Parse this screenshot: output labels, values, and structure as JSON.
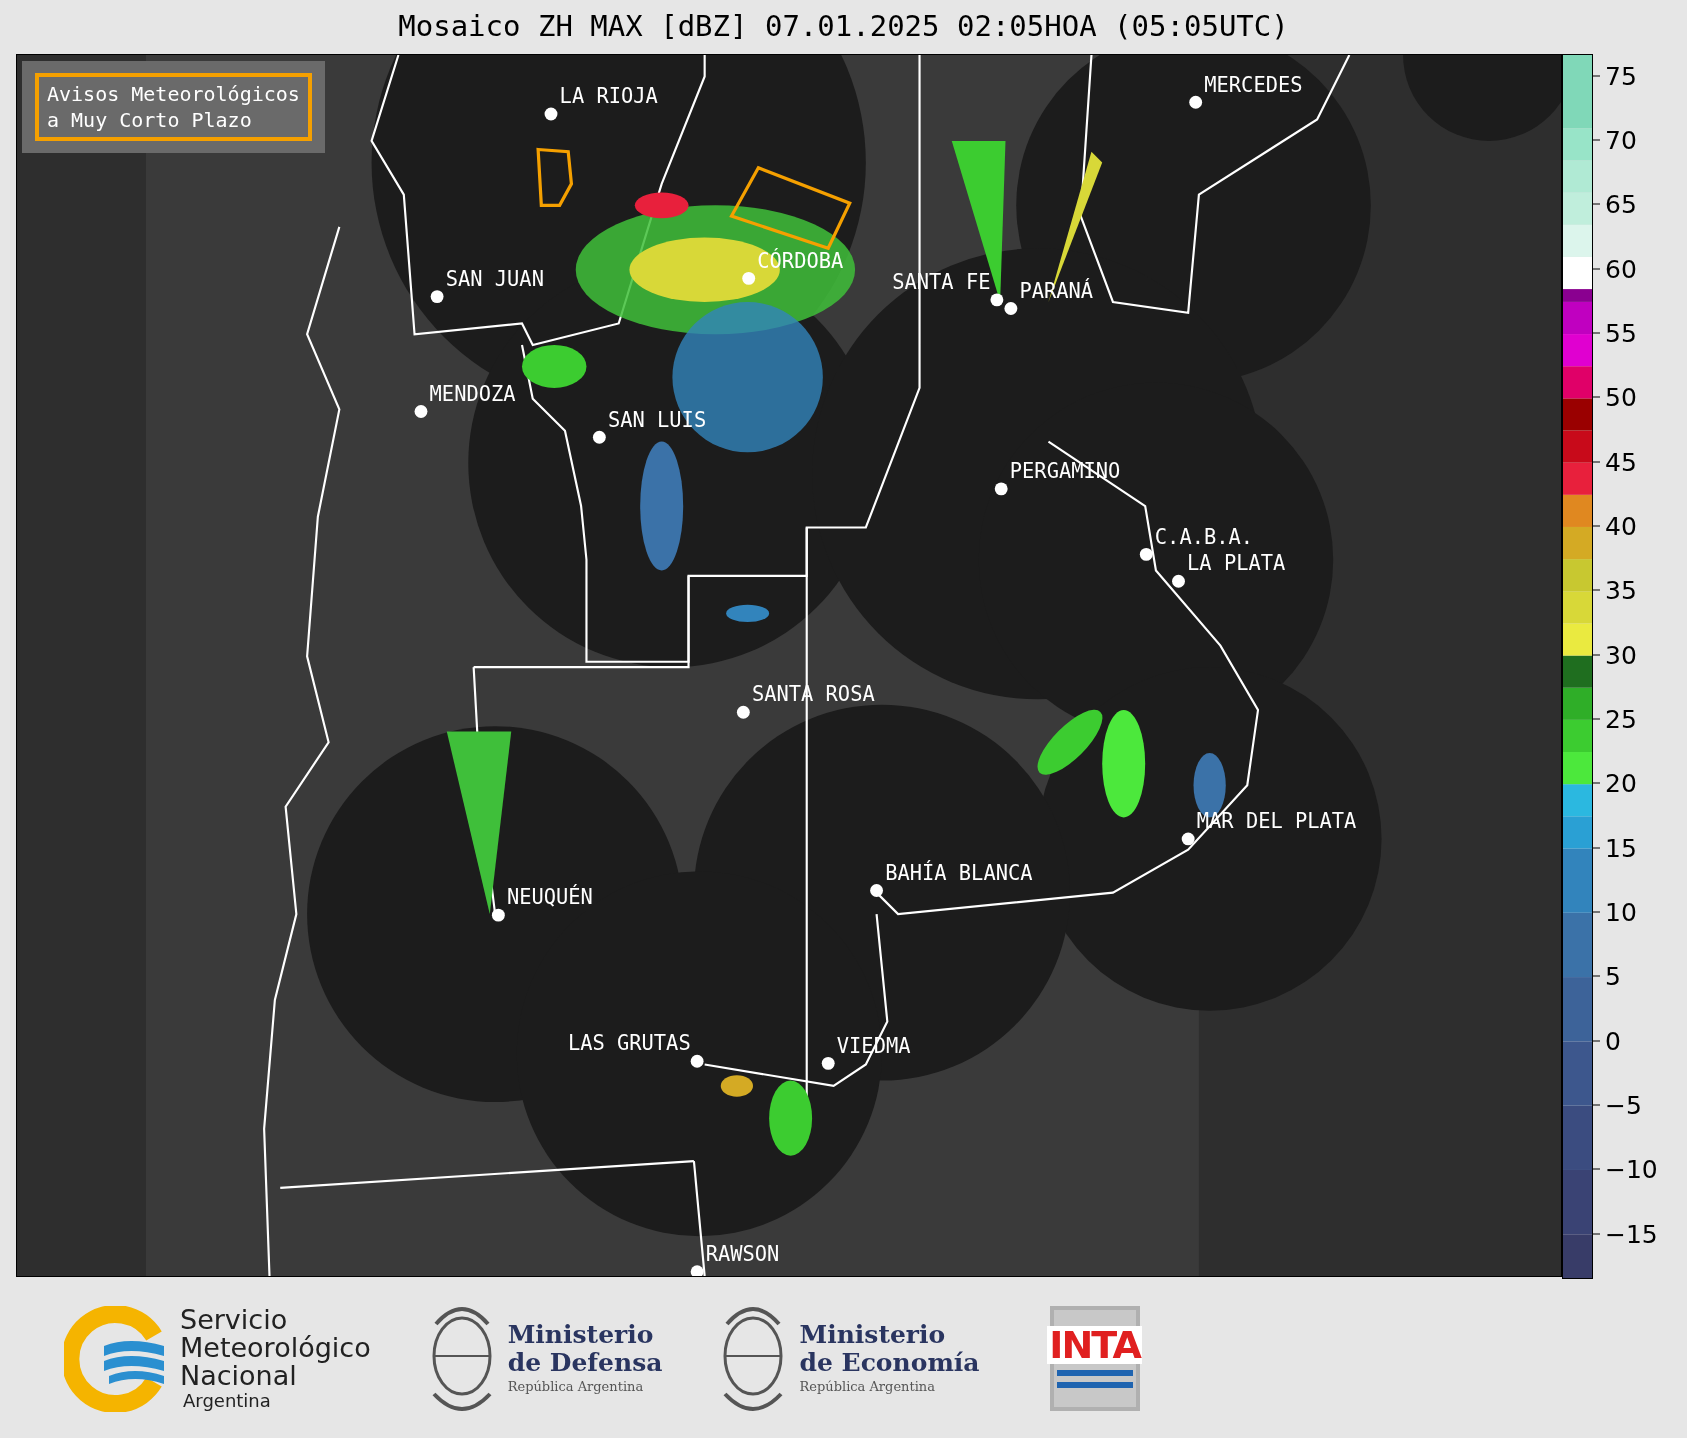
{
  "title": "Mosaico ZH MAX [dBZ] 07.01.2025 02:05HOA (05:05UTC)",
  "legend_box": {
    "lines": [
      "Avisos Meteorológicos",
      "a Muy Corto Plazo"
    ]
  },
  "cities": [
    {
      "name": "LA RIOJA"
    },
    {
      "name": "MERCEDES"
    },
    {
      "name": "CÓRDOBA"
    },
    {
      "name": "SAN JUAN"
    },
    {
      "name": "SANTA FE"
    },
    {
      "name": "PARANÁ"
    },
    {
      "name": "MENDOZA"
    },
    {
      "name": "SAN LUIS"
    },
    {
      "name": "PERGAMINO"
    },
    {
      "name": "C.A.B.A."
    },
    {
      "name": "LA PLATA"
    },
    {
      "name": "SANTA ROSA"
    },
    {
      "name": "MAR DEL PLATA"
    },
    {
      "name": "BAHÍA BLANCA"
    },
    {
      "name": "NEUQUÉN"
    },
    {
      "name": "LAS GRUTAS"
    },
    {
      "name": "VIEDMA"
    },
    {
      "name": "RAWSON"
    }
  ],
  "colorbar": {
    "ticks": [
      "75",
      "70",
      "65",
      "60",
      "55",
      "50",
      "45",
      "40",
      "35",
      "30",
      "25",
      "20",
      "15",
      "10",
      "5",
      "0",
      "−5",
      "−10",
      "−15"
    ]
  },
  "footer": {
    "logos": [
      {
        "kind": "smn",
        "lines": [
          "Servicio",
          "Meteorológico",
          "Nacional"
        ],
        "subtitle": "Argentina"
      },
      {
        "kind": "ministry",
        "lines": [
          "Ministerio",
          "de Defensa"
        ],
        "subtitle": "República Argentina"
      },
      {
        "kind": "ministry",
        "lines": [
          "Ministerio",
          "de Economía"
        ],
        "subtitle": "República Argentina"
      },
      {
        "kind": "inta",
        "lines": [
          "INTA"
        ]
      }
    ]
  }
}
